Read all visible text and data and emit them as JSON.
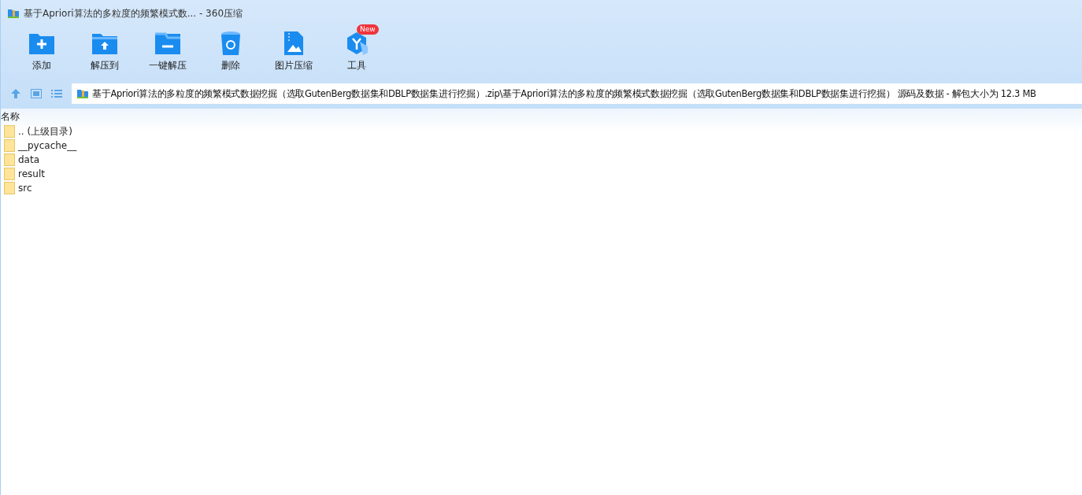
{
  "window": {
    "title": "基于Apriori算法的多粒度的频繁模式数... - 360压缩"
  },
  "toolbar": [
    {
      "label": "添加",
      "kind": "add"
    },
    {
      "label": "解压到",
      "kind": "extract"
    },
    {
      "label": "一键解压",
      "kind": "oneclick"
    },
    {
      "label": "删除",
      "kind": "delete"
    },
    {
      "label": "图片压缩",
      "kind": "image"
    },
    {
      "label": "工具",
      "kind": "tools",
      "badge": "New"
    }
  ],
  "address_bar": {
    "path": "基于Apriori算法的多粒度的频繁模式数据挖掘（选取GutenBerg数据集和DBLP数据集进行挖掘）.zip\\基于Apriori算法的多粒度的频繁模式数据挖掘（选取GutenBerg数据集和DBLP数据集进行挖掘） 源码及数据 - 解包大小为 12.3 MB"
  },
  "file_list": {
    "columns": [
      "名称"
    ],
    "rows": [
      {
        "name": ".. (上级目录)"
      },
      {
        "name": "__pycache__"
      },
      {
        "name": "data"
      },
      {
        "name": "result"
      },
      {
        "name": "src"
      }
    ]
  }
}
